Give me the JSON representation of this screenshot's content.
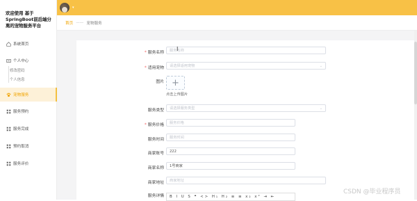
{
  "app": {
    "title": "欢迎使用 基于SpringBoot前后端分离的宠物服务平台"
  },
  "sidebar": {
    "items": [
      {
        "label": "系统首页"
      },
      {
        "label": "个人中心"
      },
      {
        "label": "修改密码"
      },
      {
        "label": "个人信息"
      },
      {
        "label": "宠物服务"
      },
      {
        "label": "服务预约"
      },
      {
        "label": "服务完成"
      },
      {
        "label": "预约取消"
      },
      {
        "label": "服务评价"
      }
    ],
    "active_index": 4
  },
  "breadcrumb": {
    "home": "首页",
    "current": "宠物服务"
  },
  "form": {
    "service_name": {
      "label": "服务名称",
      "placeholder": "服务名称",
      "required": true
    },
    "applicable_pet": {
      "label": "适用宠物",
      "placeholder": "请选择适用宠物",
      "required": true
    },
    "image": {
      "label": "图片",
      "hint": "点击上传图片"
    },
    "service_type": {
      "label": "服务类型",
      "placeholder": "请选择服务类型"
    },
    "service_price": {
      "label": "服务价格",
      "placeholder": "服务价格",
      "required": true
    },
    "service_time": {
      "label": "服务时间",
      "placeholder": "服务时间"
    },
    "merchant_account": {
      "label": "商家账号",
      "value": "222"
    },
    "merchant_name": {
      "label": "商家名称",
      "value": "1号商家"
    },
    "merchant_address": {
      "label": "商家地址",
      "placeholder": "商家地址"
    },
    "service_detail": {
      "label": "服务详情",
      "toolbar": "B I U S  ❝ <> H₁ H₂ ≡ ≡ x₂ x² ⇥ ⇤"
    }
  },
  "watermark": "CSDN @毕业程序员"
}
